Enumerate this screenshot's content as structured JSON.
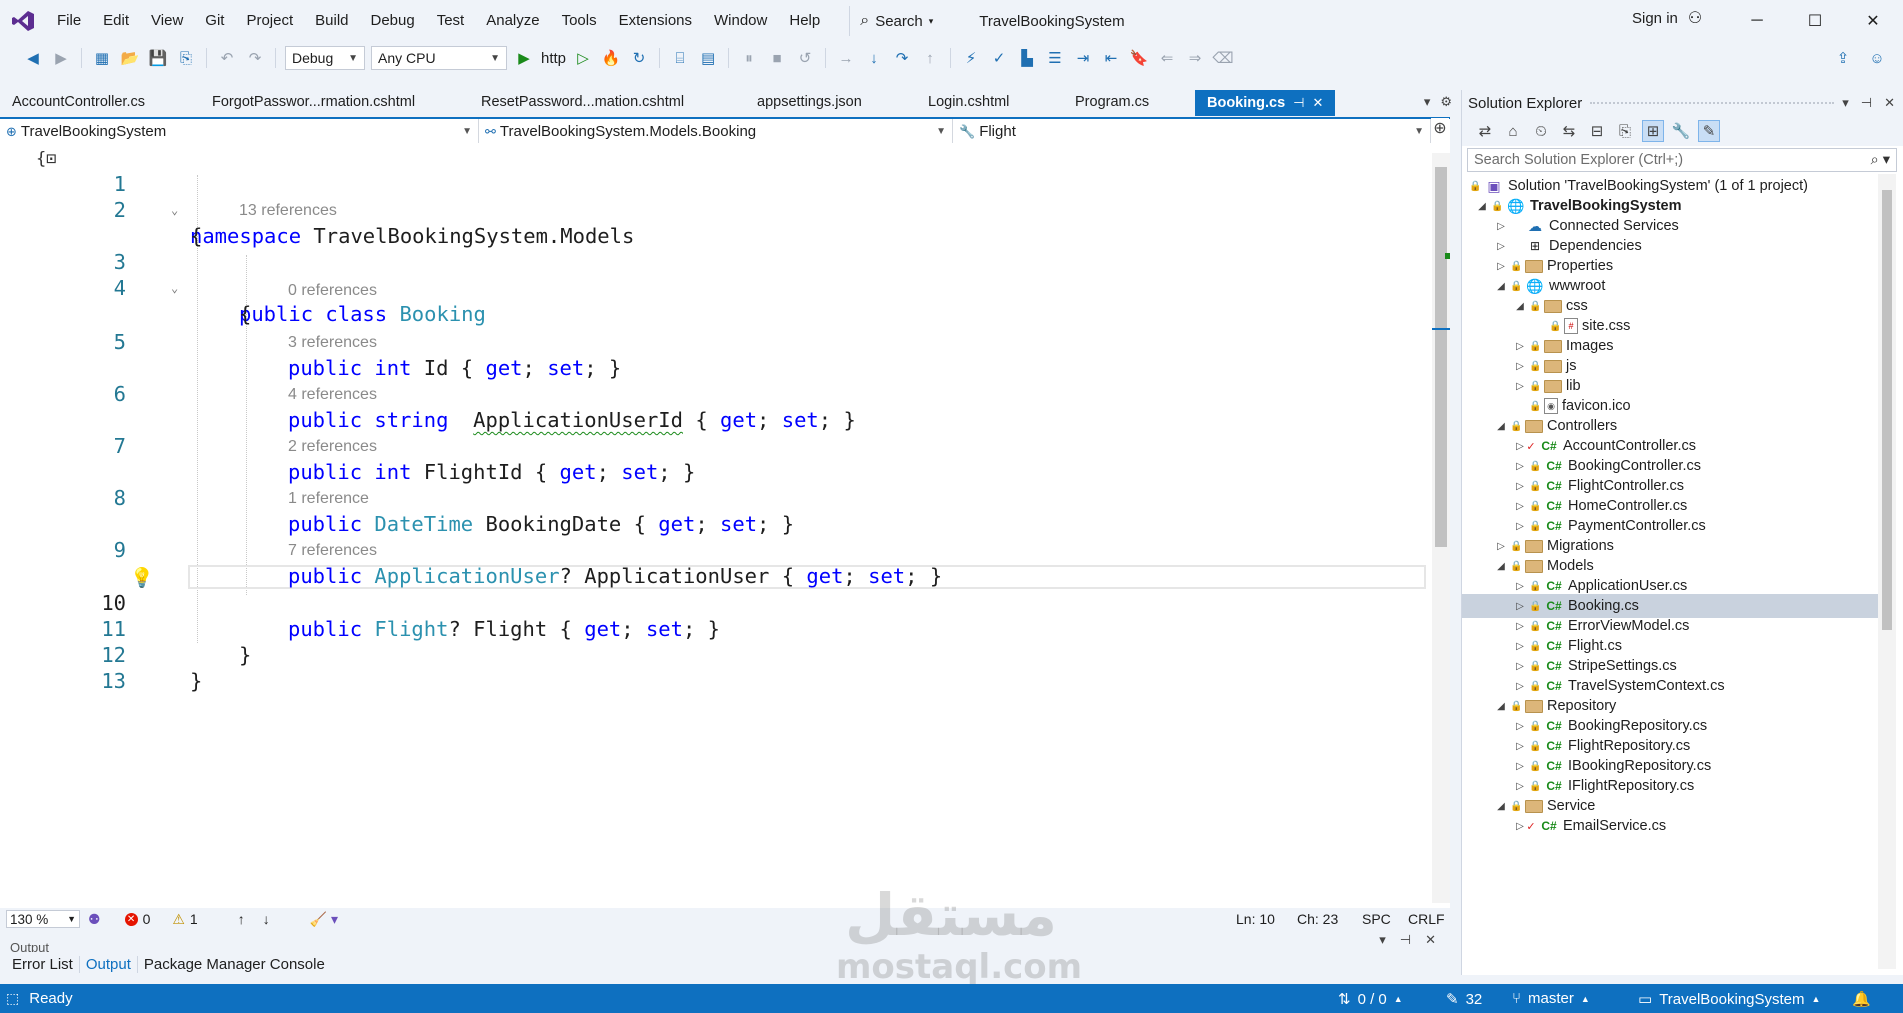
{
  "menu": {
    "items": [
      "File",
      "Edit",
      "View",
      "Git",
      "Project",
      "Build",
      "Debug",
      "Test",
      "Analyze",
      "Tools",
      "Extensions",
      "Window",
      "Help"
    ],
    "search_label": "Search",
    "solution_title": "TravelBookingSystem",
    "sign_in": "Sign in"
  },
  "toolbar": {
    "configuration": "Debug",
    "platform": "Any CPU",
    "run_profile": "http"
  },
  "tabs": [
    {
      "label": "AccountController.cs"
    },
    {
      "label": "ForgotPasswor...rmation.cshtml"
    },
    {
      "label": "ResetPassword...mation.cshtml"
    },
    {
      "label": "appsettings.json"
    },
    {
      "label": "Login.cshtml"
    },
    {
      "label": "Program.cs"
    },
    {
      "label": "Booking.cs",
      "active": true
    }
  ],
  "navbar": {
    "project": "TravelBookingSystem",
    "type": "TravelBookingSystem.Models.Booking",
    "member": "Flight"
  },
  "editor": {
    "line_numbers": [
      "1",
      "2",
      "3",
      "4",
      "5",
      "6",
      "7",
      "8",
      "9",
      "10",
      "11",
      "12",
      "13"
    ],
    "references": [
      "13 references",
      "0 references",
      "3 references",
      "4 references",
      "2 references",
      "1 reference",
      "7 references"
    ],
    "code": {
      "l1_kw": "namespace",
      "l1_rest": " TravelBookingSystem.Models",
      "l2": "{",
      "l3_kw1": "public",
      "l3_kw2": "class",
      "l3_type": "Booking",
      "l4": "{",
      "l5_kw1": "public",
      "l5_kw2": "int",
      "l5_name": " Id { ",
      "l5_get": "get",
      "l5_sep": "; ",
      "l5_set": "set",
      "l5_end": "; }",
      "l6_kw1": "public",
      "l6_kw2": "string",
      "l6_sp": "  ",
      "l6_name": "ApplicationUserId",
      "l6_open": " { ",
      "l6_get": "get",
      "l6_sep": "; ",
      "l6_set": "set",
      "l6_end": "; }",
      "l7_kw1": "public",
      "l7_kw2": "int",
      "l7_name": " FlightId { ",
      "l7_get": "get",
      "l7_sep": "; ",
      "l7_set": "set",
      "l7_end": "; }",
      "l8_kw": "public",
      "l8_type": "DateTime",
      "l8_name": " BookingDate { ",
      "l8_get": "get",
      "l8_sep": "; ",
      "l8_set": "set",
      "l8_end": "; }",
      "l9_kw": "public",
      "l9_type": "ApplicationUser",
      "l9_name": "? ApplicationUser { ",
      "l9_get": "get",
      "l9_sep": "; ",
      "l9_set": "set",
      "l9_end": "; }",
      "l10_kw": "public",
      "l10_type": "Flight",
      "l10_name": "? Flight { ",
      "l10_get": "get",
      "l10_sep": "; ",
      "l10_set": "set",
      "l10_end": "; }",
      "l11": "}",
      "l12": "}"
    }
  },
  "editor_status": {
    "zoom": "130 %",
    "errors": "0",
    "warnings": "1",
    "line": "Ln: 10",
    "char": "Ch: 23",
    "whitespace": "SPC",
    "line_ending": "CRLF"
  },
  "output_panel": {
    "title": "Output",
    "tabs": [
      "Error List",
      "Output",
      "Package Manager Console"
    ]
  },
  "solution_explorer": {
    "title": "Solution Explorer",
    "search_placeholder": "Search Solution Explorer (Ctrl+;)",
    "tree": [
      {
        "label": "Solution 'TravelBookingSystem' (1 of 1 project)",
        "icon": "solution-icon"
      },
      {
        "label": "TravelBookingSystem",
        "icon": "web-project-icon"
      },
      {
        "label": "Connected Services",
        "icon": "connected-services-icon"
      },
      {
        "label": "Dependencies",
        "icon": "dependencies-icon"
      },
      {
        "label": "Properties",
        "icon": "properties-icon"
      },
      {
        "label": "wwwroot",
        "icon": "globe-icon"
      },
      {
        "label": "css",
        "icon": "folder-icon"
      },
      {
        "label": "site.css",
        "icon": "css-file-icon"
      },
      {
        "label": "Images",
        "icon": "folder-icon"
      },
      {
        "label": "js",
        "icon": "folder-icon"
      },
      {
        "label": "lib",
        "icon": "folder-icon"
      },
      {
        "label": "favicon.ico",
        "icon": "ico-file-icon"
      },
      {
        "label": "Controllers",
        "icon": "folder-icon"
      },
      {
        "label": "AccountController.cs",
        "icon": "csharp-file-icon"
      },
      {
        "label": "BookingController.cs",
        "icon": "csharp-file-icon"
      },
      {
        "label": "FlightController.cs",
        "icon": "csharp-file-icon"
      },
      {
        "label": "HomeController.cs",
        "icon": "csharp-file-icon"
      },
      {
        "label": "PaymentController.cs",
        "icon": "csharp-file-icon"
      },
      {
        "label": "Migrations",
        "icon": "folder-icon"
      },
      {
        "label": "Models",
        "icon": "folder-icon"
      },
      {
        "label": "ApplicationUser.cs",
        "icon": "csharp-file-icon"
      },
      {
        "label": "Booking.cs",
        "icon": "csharp-file-icon",
        "selected": true
      },
      {
        "label": "ErrorViewModel.cs",
        "icon": "csharp-file-icon"
      },
      {
        "label": "Flight.cs",
        "icon": "csharp-file-icon"
      },
      {
        "label": "StripeSettings.cs",
        "icon": "csharp-file-icon"
      },
      {
        "label": "TravelSystemContext.cs",
        "icon": "csharp-file-icon"
      },
      {
        "label": "Repository",
        "icon": "folder-icon"
      },
      {
        "label": "BookingRepository.cs",
        "icon": "csharp-file-icon"
      },
      {
        "label": "FlightRepository.cs",
        "icon": "csharp-file-icon"
      },
      {
        "label": "IBookingRepository.cs",
        "icon": "csharp-file-icon"
      },
      {
        "label": "IFlightRepository.cs",
        "icon": "csharp-file-icon"
      },
      {
        "label": "Service",
        "icon": "folder-icon"
      },
      {
        "label": "EmailService.cs",
        "icon": "csharp-file-icon"
      }
    ]
  },
  "watermark": {
    "arabic": "مستقل",
    "latin": "mostaql.com"
  },
  "statusbar": {
    "status": "Ready",
    "sync": "0 / 0",
    "changes": "32",
    "branch": "master",
    "repo": "TravelBookingSystem"
  },
  "colors": {
    "accent": "#0e70c0",
    "keyword": "#0000ff",
    "type": "#2b91af",
    "chrome_bg": "#eff3f9"
  }
}
